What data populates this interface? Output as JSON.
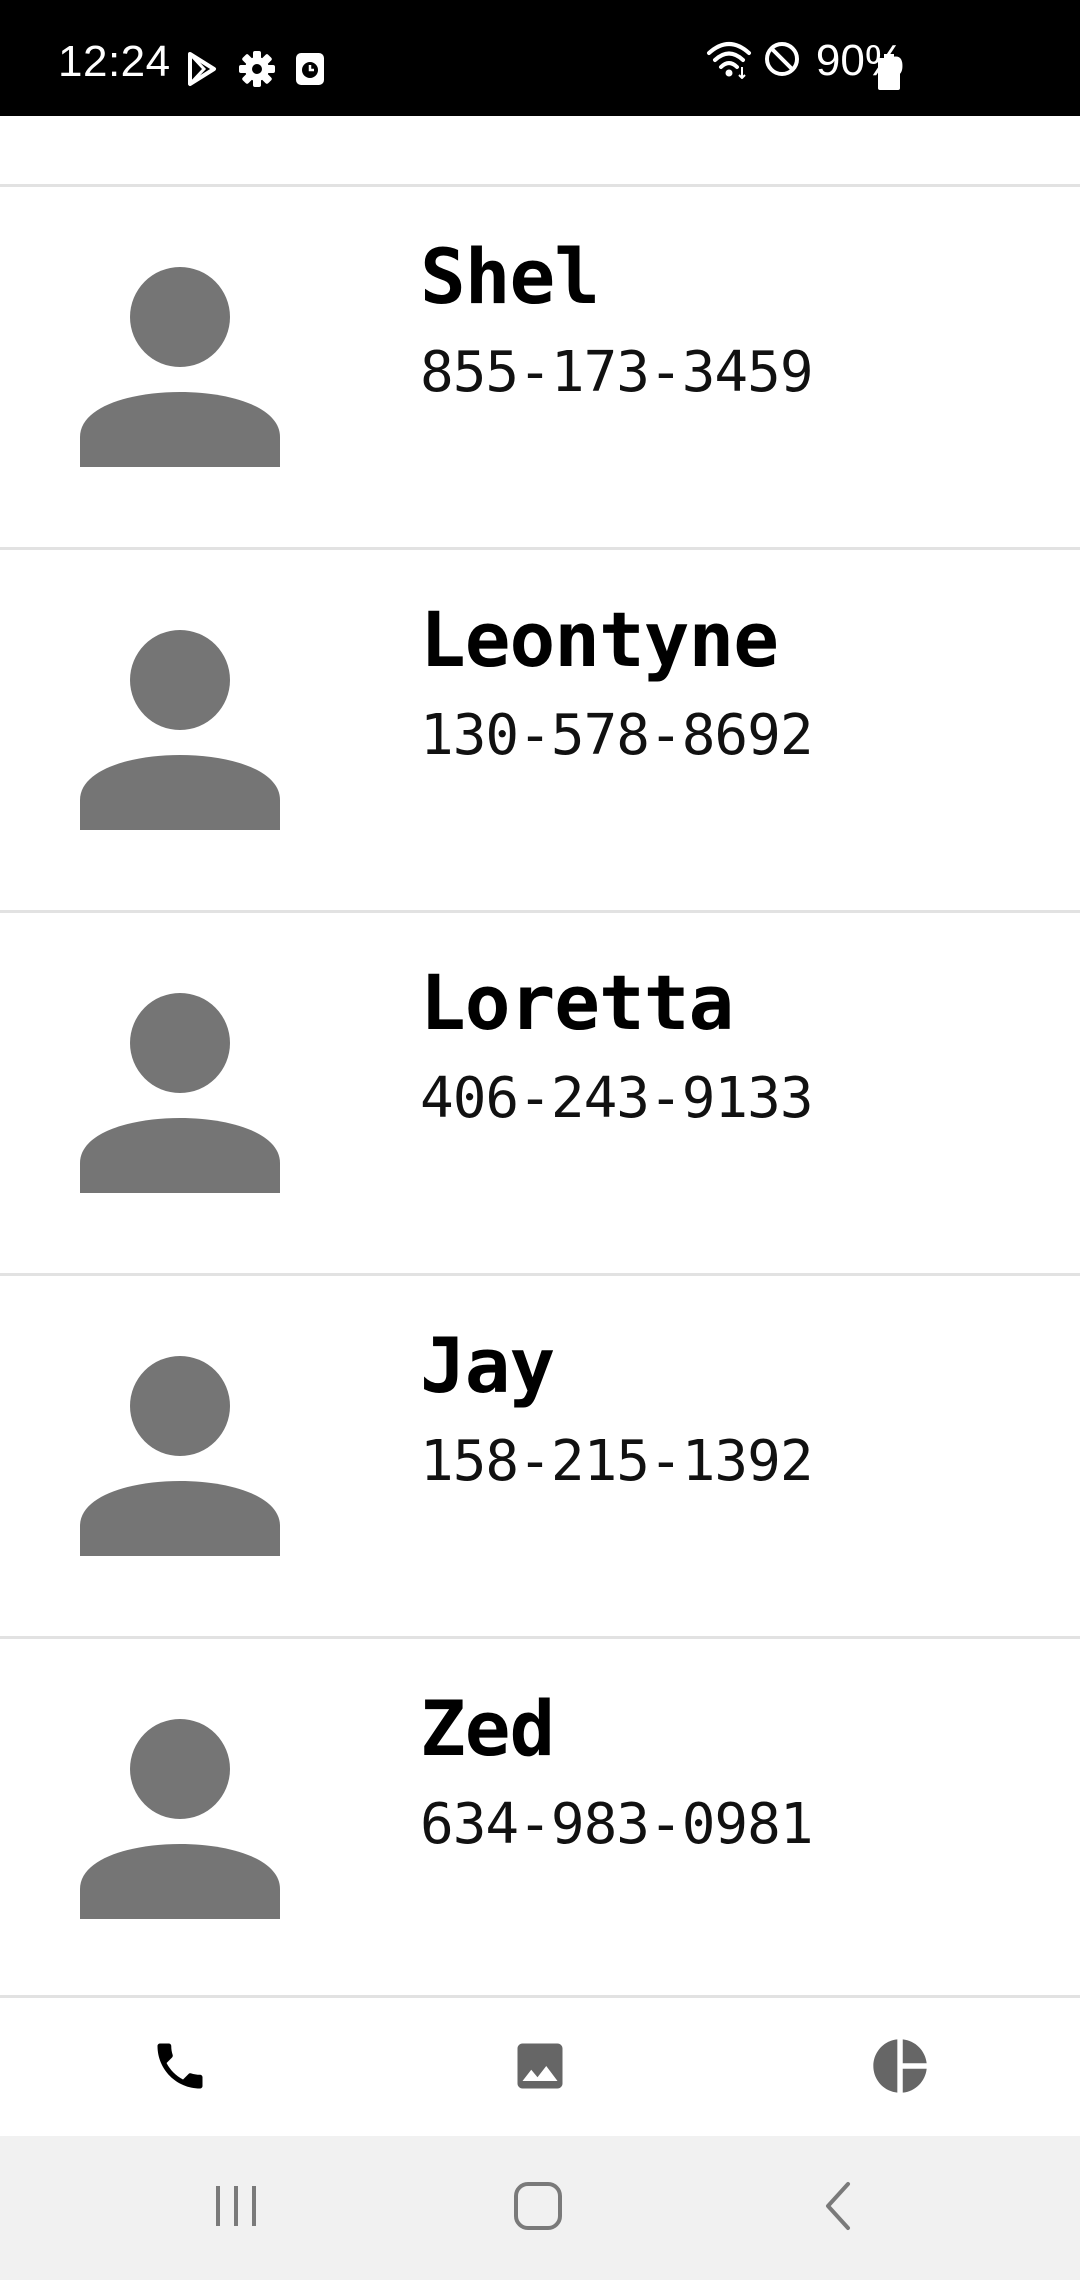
{
  "status_bar": {
    "time": "12:24",
    "battery_text": "90%",
    "icons": [
      "play-store-icon",
      "settings-gear-icon",
      "clock-app-icon",
      "wifi-icon",
      "do-not-disturb-icon",
      "battery-icon"
    ]
  },
  "contacts": [
    {
      "name": "Shel",
      "phone": "855-173-3459"
    },
    {
      "name": "Leontyne",
      "phone": "130-578-8692"
    },
    {
      "name": "Loretta",
      "phone": "406-243-9133"
    },
    {
      "name": "Jay",
      "phone": "158-215-1392"
    },
    {
      "name": "Zed",
      "phone": "634-983-0981"
    }
  ],
  "tabs": [
    {
      "icon": "phone-icon",
      "active": true
    },
    {
      "icon": "image-icon",
      "active": false
    },
    {
      "icon": "pie-chart-icon",
      "active": false
    }
  ],
  "nav": [
    "recents-icon",
    "home-icon",
    "back-icon"
  ],
  "colors": {
    "avatar": "#757575",
    "tab_active": "#000000",
    "tab_inactive": "#666666",
    "divider": "#e2e2e2",
    "nav_bg": "#f1f1f1",
    "status_bg": "#000000"
  }
}
